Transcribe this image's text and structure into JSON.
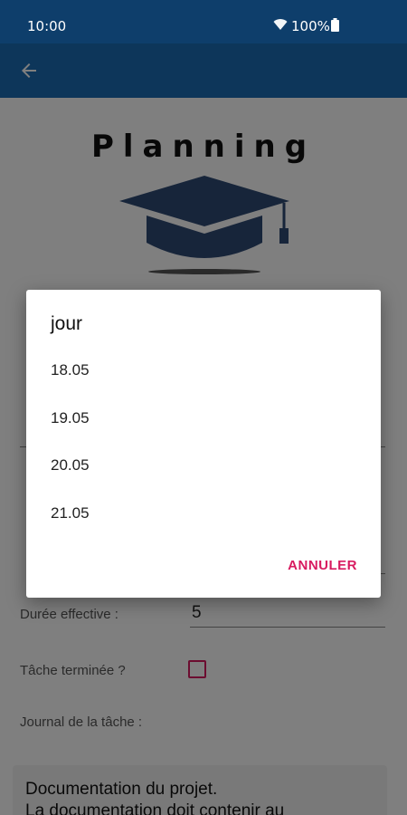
{
  "status_bar": {
    "time": "10:00",
    "battery": "100%"
  },
  "app_bar": {
    "back_icon": "arrow-left-icon"
  },
  "header": {
    "title": "Planning",
    "logo_icon": "graduation-cap-icon"
  },
  "form": {
    "duree_effective_label": "Durée effective :",
    "duree_effective_value": "5",
    "tache_terminee_label": "Tâche terminée ?",
    "tache_terminee_checked": false,
    "journal_label": "Journal de la tâche :",
    "journal_text": "Documentation du projet.\nLa documentation doit contenir au"
  },
  "dialog": {
    "title": "jour",
    "options": [
      "18.05",
      "19.05",
      "20.05",
      "21.05"
    ],
    "cancel_label": "ANNULER"
  },
  "colors": {
    "status_bar": "#0e3e6b",
    "app_bar": "#1a6cb4",
    "accent": "#d81b60",
    "cap": "#2f4a75"
  }
}
